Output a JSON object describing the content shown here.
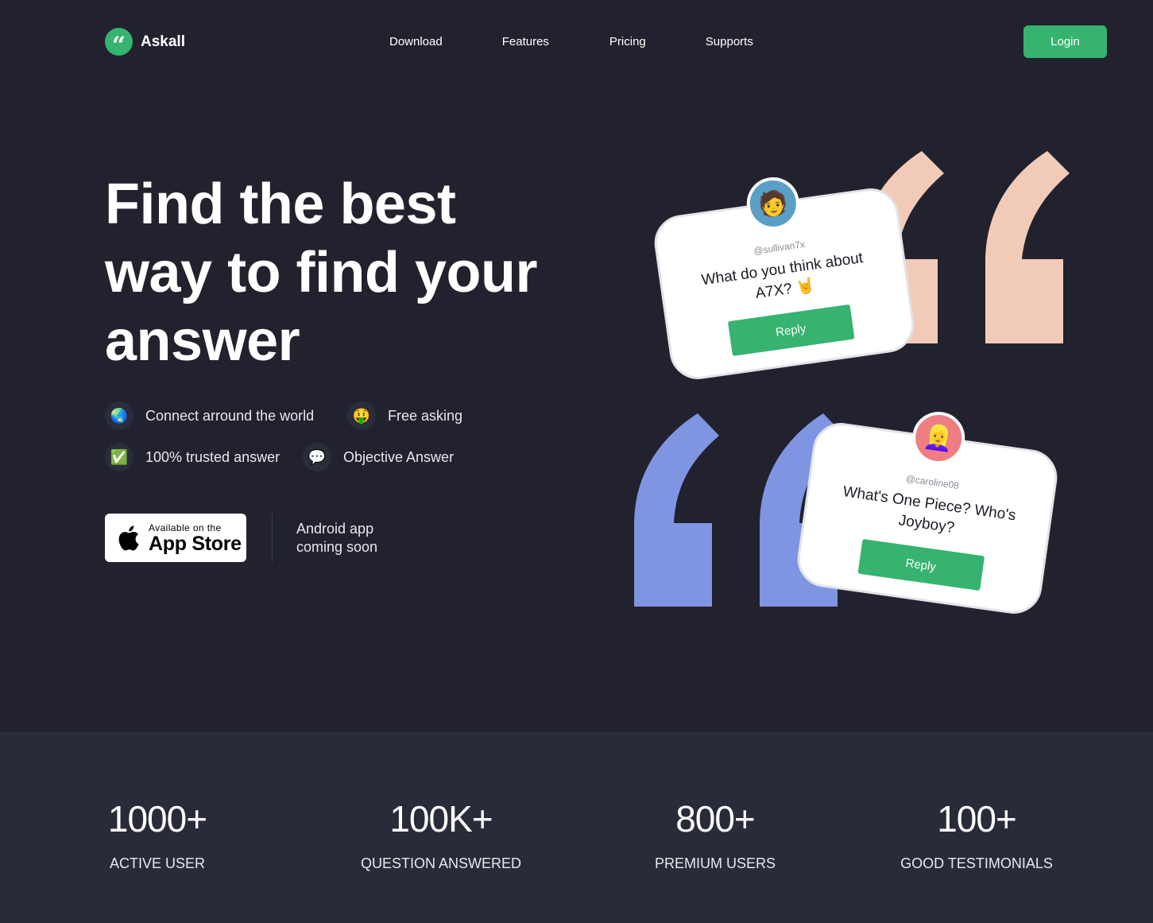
{
  "brand": {
    "name": "Askall",
    "logo_glyph": "“",
    "accent": "#35b36f"
  },
  "nav": {
    "items": [
      {
        "label": "Download"
      },
      {
        "label": "Features"
      },
      {
        "label": "Pricing"
      },
      {
        "label": "Supports"
      }
    ],
    "login_label": "Login"
  },
  "hero": {
    "title": "Find the best way to find your answer",
    "features": [
      {
        "icon": "globe-icon",
        "emoji": "🌏",
        "label": "Connect arround the world"
      },
      {
        "icon": "money-face-icon",
        "emoji": "🤑",
        "label": "Free asking"
      },
      {
        "icon": "check-icon",
        "emoji": "✅",
        "label": "100% trusted answer"
      },
      {
        "icon": "speech-bubble-icon",
        "emoji": "💬",
        "label": "Objective Answer"
      }
    ],
    "app_store": {
      "small": "Available on the",
      "big": "App Store"
    },
    "android_note": "Android app coming soon"
  },
  "cards": [
    {
      "username": "@sullivan7x",
      "question": "What do you think about A7X? 🤘",
      "reply_label": "Reply",
      "avatar_emoji": "🧑",
      "quote_color": "#f2cbb8"
    },
    {
      "username": "@caroline08",
      "question": "What's One Piece? Who's Joyboy?",
      "reply_label": "Reply",
      "avatar_emoji": "👱‍♀️",
      "quote_color": "#7f95e2"
    }
  ],
  "stats": [
    {
      "value": "1000+",
      "label": "ACTIVE USER"
    },
    {
      "value": "100K+",
      "label": "QUESTION ANSWERED"
    },
    {
      "value": "800+",
      "label": "PREMIUM USERS"
    },
    {
      "value": "100+",
      "label": "GOOD TESTIMONIALS"
    }
  ]
}
